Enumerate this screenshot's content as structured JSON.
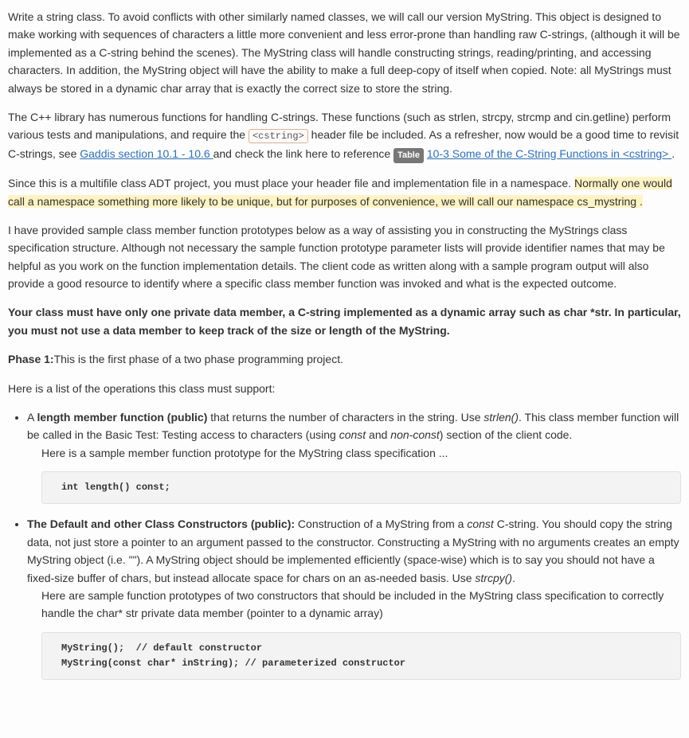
{
  "p1": {
    "text": "Write a string class. To avoid conflicts with other similarly named classes, we will call our version MyString. This object is designed to make working with sequences of characters a little more convenient and less error-prone than handling raw C-strings, (although it will be implemented as a C-string behind the scenes). The MyString class will handle constructing strings, reading/printing, and accessing characters. In addition, the MyString object will have the ability to make a full deep-copy of itself when copied. Note: all MyStrings must always be stored in a dynamic char array that is exactly the correct size to store the string."
  },
  "p2": {
    "a": "The C++ library has numerous functions for handling C-strings. These functions (such as strlen, strcpy, strcmp and cin.getline) perform various tests and manipulations, and require the ",
    "code": "<cstring>",
    "b": " header file be included. As a  refresher, now would be a good time to revisit C-strings, see ",
    "link1": "Gaddis section 10.1 - 10.6 ",
    "c": "and check the link here to reference ",
    "badge": "Table",
    "link2": "10-3 Some of the C-String Functions in <cstring> ",
    "d": "."
  },
  "p3": {
    "a": "Since this is a multifile class ADT project, you must place your header file and implementation file in a namespace. ",
    "hl": "Normally one would call a namespace something more likely to be unique, but for purposes of convenience, we will call our namespace cs_mystring .",
    "hl_part1": "Normally one would call a namespace something more likely to be unique, but for purposes of convenience, we will call our ",
    "hl_bold": "namespace cs_mystring",
    "hl_part2": " ."
  },
  "p4": {
    "text": "I have provided sample class member function prototypes below as a way of assisting you in constructing the MyStrings class specification structure. Although not necessary the sample function prototype parameter lists will provide identifier names that may be helpful as you work on the function implementation details. The client code as written along with a sample program output will also provide a good resource to identify where a specific class member function was invoked and what is the expected outcome."
  },
  "p5": {
    "text": "Your class must have only one private data member, a C-string implemented as a dynamic array such as char *str.  In particular, you must not use a data member to keep track of the size or length of the MyString."
  },
  "p6": {
    "bold": "Phase 1:",
    "rest": "This is the first phase of a two phase programming project."
  },
  "p7": {
    "text": "Here is a list of the operations this class must support:"
  },
  "li1": {
    "a": "A ",
    "bold": "length member function (public)",
    "b": " that returns the number of characters in the string. Use ",
    "it1": "strlen()",
    "c": ". This class member function will be called in the Basic Test: Testing access to characters (using ",
    "it2": "const",
    "d": " and ",
    "it3": "non-const",
    "e": ")  section of the client code.",
    "sub": "Here is a sample member function prototype for the MyString class specification ...",
    "code": "int length() const;"
  },
  "li2": {
    "bold": "The Default and other Class Constructors (public): ",
    "a": "Construction of a MyString from a ",
    "it1": "const",
    "b": " C-string. You should copy the string data, not just store a pointer to an argument passed to the constructor. Constructing a MyString with no arguments creates an empty MyString object (i.e. \"\"). A MyString object should be implemented efficiently (space-wise) which is to say you should not have a fixed-size buffer of chars, but instead allocate space for chars on an as-needed basis. Use ",
    "it2": "strcpy()",
    "c": ".",
    "sub": "Here are sample function prototypes of two constructors that should be included in the MyString class specification to correctly handle the char* str private data member (pointer to a dynamic array)",
    "code": "MyString();  // default constructor\nMyString(const char* inString); // parameterized constructor"
  }
}
